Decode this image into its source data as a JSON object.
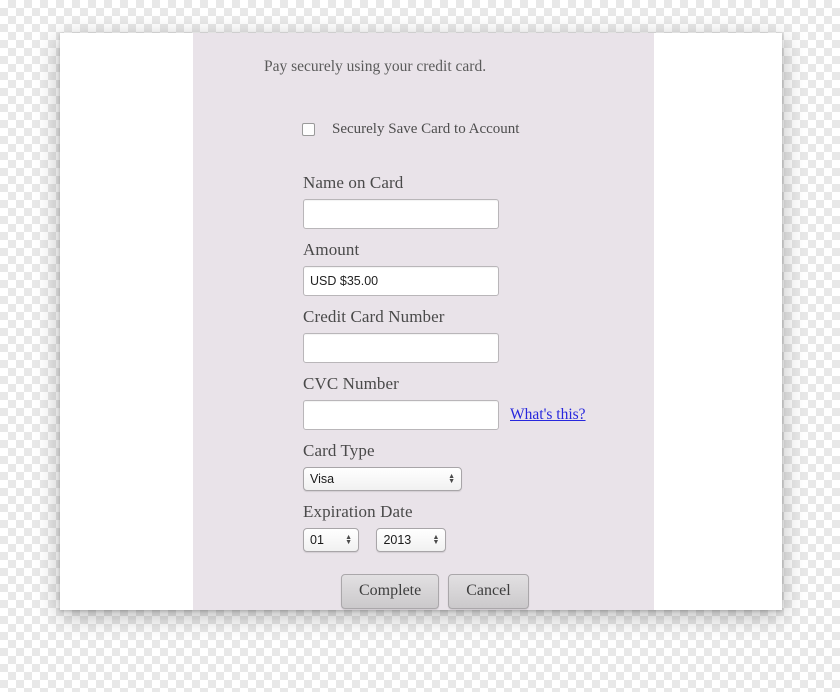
{
  "panel": {
    "intro_text": "Pay securely using your credit card.",
    "save_card_label": "Securely Save Card to Account",
    "fields": {
      "name_label": "Name on Card",
      "name_value": "",
      "amount_label": "Amount",
      "amount_value": "USD $35.00",
      "card_number_label": "Credit Card Number",
      "card_number_value": "",
      "cvc_label": "CVC Number",
      "cvc_value": "",
      "whats_this_link": "What's this?",
      "card_type_label": "Card Type",
      "card_type_value": "Visa",
      "expiration_label": "Expiration Date",
      "expiration_month": "01",
      "expiration_year": "2013"
    },
    "buttons": {
      "complete_label": "Complete",
      "cancel_label": "Cancel"
    }
  },
  "colors": {
    "panel_bg": "#e9e3e9",
    "link": "#2727dd",
    "text": "#4a4a4a"
  }
}
